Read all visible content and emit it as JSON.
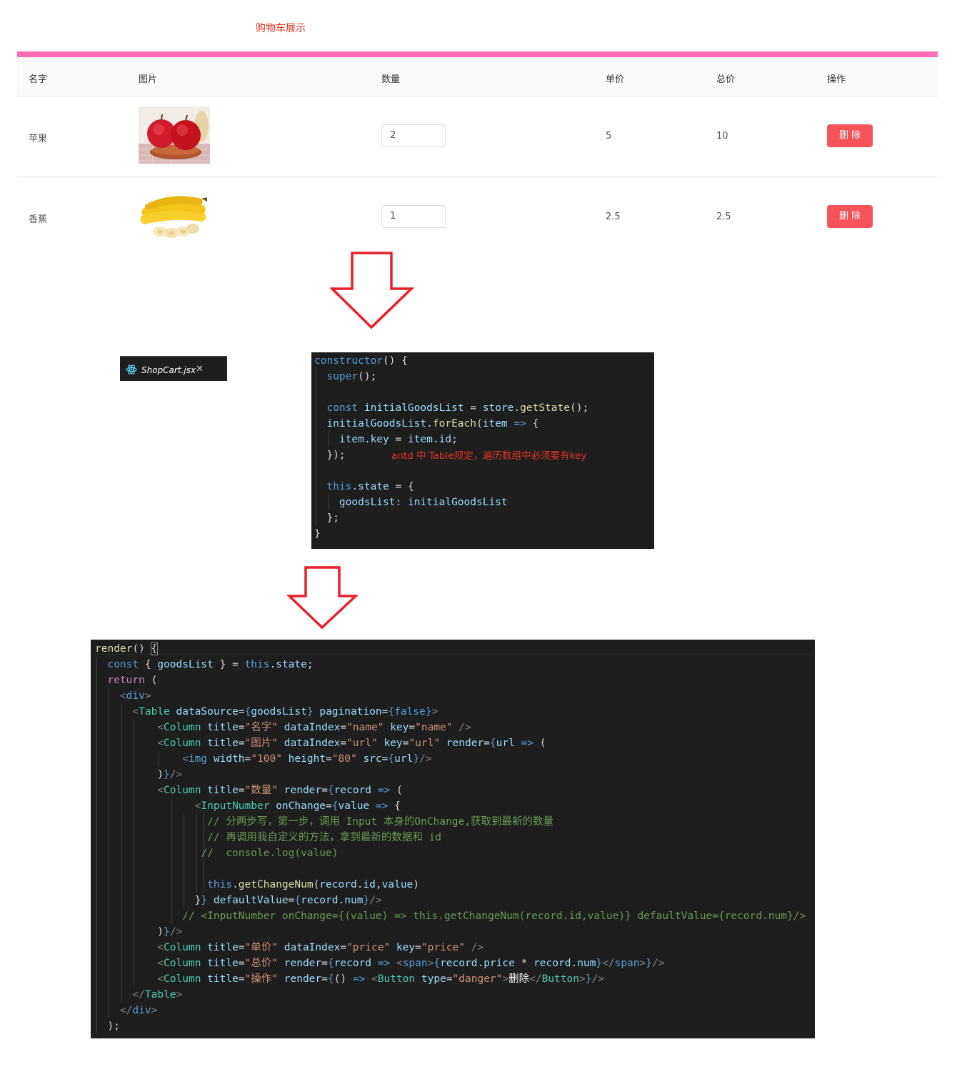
{
  "page": {
    "title": "购物车展示"
  },
  "table": {
    "columns": [
      "名字",
      "图片",
      "数量",
      "单价",
      "总价",
      "操作"
    ],
    "rows": [
      {
        "name": "苹果",
        "image": "apple-photo",
        "quantity": "2",
        "price": "5",
        "total": "10",
        "action": "删 除"
      },
      {
        "name": "香蕉",
        "image": "banana-photo",
        "quantity": "1",
        "price": "2.5",
        "total": "2.5",
        "action": "删 除"
      }
    ]
  },
  "colors": {
    "accent_bar": "#ff6eb4",
    "danger": "#f5525a",
    "title": "#e0301e",
    "editor_bg": "#1e1e1e"
  },
  "editor": {
    "tab_label": "ShopCart.jsx",
    "tab_icon": "react-icon",
    "close_icon": "close-icon"
  },
  "code1": {
    "annotation": "antd 中 Table规定，遍历数组中必须要有key",
    "lines": [
      "constructor() {",
      "  super();",
      "",
      "  const initialGoodsList = store.getState();",
      "  initialGoodsList.forEach(item => {",
      "    item.key = item.id;",
      "  });",
      "",
      "  this.state = {",
      "    goodsList: initialGoodsList",
      "  };",
      "}"
    ]
  },
  "code2": {
    "lines": [
      "render() {",
      "  const { goodsList } = this.state;",
      "  return (",
      "    <div>",
      "      <Table dataSource={goodsList} pagination={false}>",
      "          <Column title=\"名字\" dataIndex=\"name\" key=\"name\" />",
      "          <Column title=\"图片\" dataIndex=\"url\" key=\"url\" render={url => (",
      "              <img width=\"100\" height=\"80\" src={url}/>",
      "          )}/>",
      "          <Column title=\"数量\" render={record => (",
      "                <InputNumber onChange={value => {",
      "                  // 分两步写，第一步，调用 Input 本身的OnChange,获取到最新的数量",
      "                  // 再调用我自定义的方法，拿到最新的数据和 id",
      "                 //  console.log(value)",
      "",
      "                  this.getChangeNum(record.id,value)",
      "                }} defaultValue={record.num}/>",
      "              // <InputNumber onChange={(value) => this.getChangeNum(record.id,value)} defaultValue={record.num}/>",
      "          )}/>",
      "          <Column title=\"单价\" dataIndex=\"price\" key=\"price\" />",
      "          <Column title=\"总价\" render={record => <span>{record.price * record.num}</span>}/>",
      "          <Column title=\"操作\" render={() => <Button type=\"danger\">删除</Button>}/>",
      "      </Table>",
      "    </div>",
      "  );"
    ]
  }
}
